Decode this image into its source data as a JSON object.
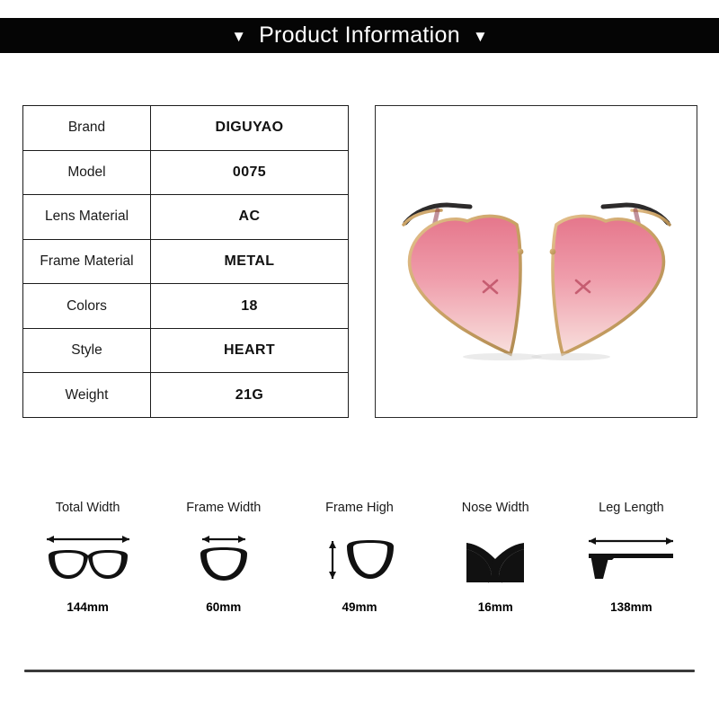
{
  "banner": {
    "title": "Product Information",
    "left_marker": "▼",
    "right_marker": "▼"
  },
  "spec_table": {
    "rows": [
      {
        "label": "Brand",
        "value": "DIGUYAO"
      },
      {
        "label": "Model",
        "value": "0075"
      },
      {
        "label": "Lens Material",
        "value": "AC"
      },
      {
        "label": "Frame Material",
        "value": "METAL"
      },
      {
        "label": "Colors",
        "value": "18"
      },
      {
        "label": "Style",
        "value": "HEART"
      },
      {
        "label": "Weight",
        "value": "21G"
      }
    ]
  },
  "product_image": {
    "alt": "heart-shaped metal sunglasses with pink gradient lenses",
    "lens_gradient_top": "#e87f92",
    "lens_gradient_bottom": "#f7dcdb",
    "frame_color": "#c8a06a",
    "temple_color": "#2b2b2b"
  },
  "measurements": [
    {
      "label": "Total Width",
      "value": "144mm",
      "icon": "glasses-front-icon"
    },
    {
      "label": "Frame Width",
      "value": "60mm",
      "icon": "single-lens-icon"
    },
    {
      "label": "Frame High",
      "value": "49mm",
      "icon": "lens-height-icon"
    },
    {
      "label": "Nose Width",
      "value": "16mm",
      "icon": "nose-bridge-icon"
    },
    {
      "label": "Leg Length",
      "value": "138mm",
      "icon": "temple-arm-icon"
    }
  ]
}
